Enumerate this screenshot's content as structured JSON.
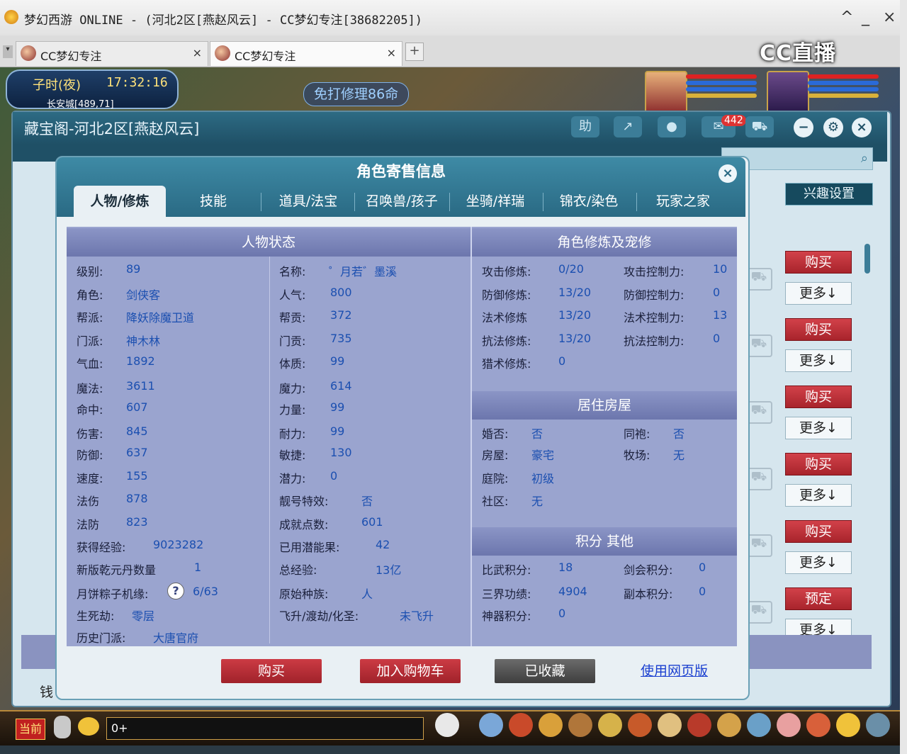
{
  "window": {
    "title": "梦幻西游 ONLINE - (河北2区[燕赵风云] - CC梦幻专注[38682205])",
    "controls": [
      "^",
      "_",
      "×"
    ]
  },
  "browser_tabs": [
    {
      "label": "CC梦幻专注",
      "close": "×"
    },
    {
      "label": "CC梦幻专注",
      "close": "×"
    }
  ],
  "new_tab": "+",
  "watermark": "CC直播",
  "game_hud": {
    "time_period": "子时(夜)",
    "time": "17:32:16",
    "location": "长安城[489,71]",
    "announcement": "免打修理86命"
  },
  "pavilion": {
    "title": "藏宝阁-河北2区[燕赵风云]",
    "help_label": "助",
    "message_badge": "442",
    "interest_button": "兴趣设置",
    "money_label": "钱",
    "list_actions": [
      {
        "primary": "购买",
        "more": "更多↓"
      },
      {
        "primary": "购买",
        "more": "更多↓"
      },
      {
        "primary": "购买",
        "more": "更多↓"
      },
      {
        "primary": "购买",
        "more": "更多↓"
      },
      {
        "primary": "购买",
        "more": "更多↓"
      },
      {
        "primary": "预定",
        "more": "更多↓"
      }
    ]
  },
  "dialog": {
    "title": "角色寄售信息",
    "close": "×",
    "tabs": [
      "人物/修炼",
      "技能",
      "道具/法宝",
      "召唤兽/孩子",
      "坐骑/祥瑞",
      "锦衣/染色",
      "玩家之家"
    ],
    "active_tab": 0,
    "status": {
      "heading": "人物状态",
      "left": [
        {
          "label": "级别:",
          "value": "89"
        },
        {
          "label": "角色:",
          "value": "剑侠客"
        },
        {
          "label": "帮派:",
          "value": "降妖除魔卫道"
        },
        {
          "label": "门派:",
          "value": "神木林"
        },
        {
          "label": "气血:",
          "value": "1892"
        },
        {
          "label": "魔法:",
          "value": "3611"
        },
        {
          "label": "命中:",
          "value": "607"
        },
        {
          "label": "伤害:",
          "value": "845"
        },
        {
          "label": "防御:",
          "value": "637"
        },
        {
          "label": "速度:",
          "value": "155"
        },
        {
          "label": "法伤",
          "value": "878"
        },
        {
          "label": "法防",
          "value": "823"
        },
        {
          "label": "获得经验:",
          "value": "9023282"
        },
        {
          "label": "新版乾元丹数量",
          "value": "1"
        },
        {
          "label": "月饼粽子机缘:",
          "value": "6/63",
          "help": "?"
        },
        {
          "label": "生死劫:",
          "value": "零层"
        },
        {
          "label": "历史门派:",
          "value": "大唐官府"
        }
      ],
      "right": [
        {
          "label": "名称:",
          "value": "゜月若゛墨溪"
        },
        {
          "label": "人气:",
          "value": "800"
        },
        {
          "label": "帮贡:",
          "value": "372"
        },
        {
          "label": "门贡:",
          "value": "735"
        },
        {
          "label": "体质:",
          "value": "99"
        },
        {
          "label": "魔力:",
          "value": "614"
        },
        {
          "label": "力量:",
          "value": "99"
        },
        {
          "label": "耐力:",
          "value": "99"
        },
        {
          "label": "敏捷:",
          "value": "130"
        },
        {
          "label": "潜力:",
          "value": "0"
        },
        {
          "label": "靓号特效:",
          "value": "否"
        },
        {
          "label": "成就点数:",
          "value": "601"
        },
        {
          "label": "已用潜能果:",
          "value": "42"
        },
        {
          "label": "总经验:",
          "value": "13亿"
        },
        {
          "label": "原始种族:",
          "value": "人"
        },
        {
          "label": "飞升/渡劫/化圣:",
          "value": "未飞升"
        }
      ]
    },
    "cultivation": {
      "heading": "角色修炼及宠修",
      "rows": [
        [
          {
            "label": "攻击修炼:",
            "value": "0/20"
          },
          {
            "label": "攻击控制力:",
            "value": "10"
          }
        ],
        [
          {
            "label": "防御修炼:",
            "value": "13/20"
          },
          {
            "label": "防御控制力:",
            "value": "0"
          }
        ],
        [
          {
            "label": "法术修炼",
            "value": "13/20"
          },
          {
            "label": "法术控制力:",
            "value": "13"
          }
        ],
        [
          {
            "label": "抗法修炼:",
            "value": "13/20"
          },
          {
            "label": "抗法控制力:",
            "value": "0"
          }
        ],
        [
          {
            "label": "猎术修炼:",
            "value": "0"
          }
        ]
      ]
    },
    "house": {
      "heading": "居住房屋",
      "rows": [
        [
          {
            "label": "婚否:",
            "value": "否"
          },
          {
            "label": "同袍:",
            "value": "否"
          }
        ],
        [
          {
            "label": "房屋:",
            "value": "豪宅"
          },
          {
            "label": "牧场:",
            "value": "无"
          }
        ],
        [
          {
            "label": "庭院:",
            "value": "初级"
          }
        ],
        [
          {
            "label": "社区:",
            "value": "无"
          }
        ]
      ]
    },
    "points": {
      "heading": "积分 其他",
      "rows": [
        [
          {
            "label": "比武积分:",
            "value": "18"
          },
          {
            "label": "剑会积分:",
            "value": "0"
          }
        ],
        [
          {
            "label": "三界功绩:",
            "value": "4904"
          },
          {
            "label": "副本积分:",
            "value": "0"
          }
        ],
        [
          {
            "label": "神器积分:",
            "value": "0"
          }
        ]
      ]
    },
    "actions": {
      "buy": "购买",
      "add_to_cart": "加入购物车",
      "favorited": "已收藏",
      "web_version": "使用网页版"
    }
  },
  "chat": {
    "channel": "当前",
    "input_value": "0+"
  }
}
